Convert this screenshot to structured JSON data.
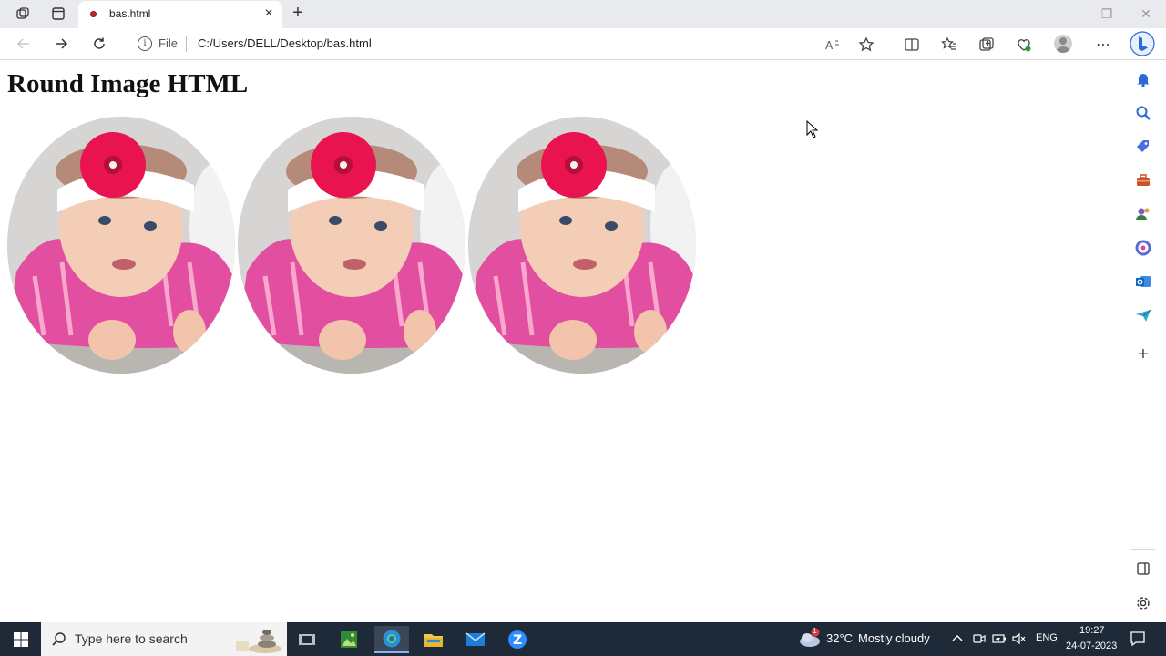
{
  "browser": {
    "tab": {
      "title": "bas.html",
      "close_glyph": "×"
    },
    "new_tab_glyph": "+",
    "window_controls": {
      "minimize": "—",
      "maximize": "❐",
      "close": "✕"
    },
    "address": {
      "scheme_label": "File",
      "url": "C:/Users/DELL/Desktop/bas.html"
    }
  },
  "page": {
    "heading": "Round Image HTML",
    "images": [
      {
        "subject": "baby with pink flower headband"
      },
      {
        "subject": "baby with pink flower headband"
      },
      {
        "subject": "baby with pink flower headband"
      }
    ]
  },
  "sidebar": {
    "items": [
      "bell-icon",
      "search-icon",
      "tag-icon",
      "briefcase-icon",
      "games-icon",
      "office-icon",
      "outlook-icon",
      "send-icon",
      "add-icon"
    ],
    "bottom": [
      "sidebar-toggle-icon",
      "settings-icon"
    ]
  },
  "taskbar": {
    "search_placeholder": "Type here to search",
    "weather": {
      "temp": "32°C",
      "desc": "Mostly cloudy",
      "badge": "1"
    },
    "language": "ENG",
    "time": "19:27",
    "date": "24-07-2023"
  }
}
